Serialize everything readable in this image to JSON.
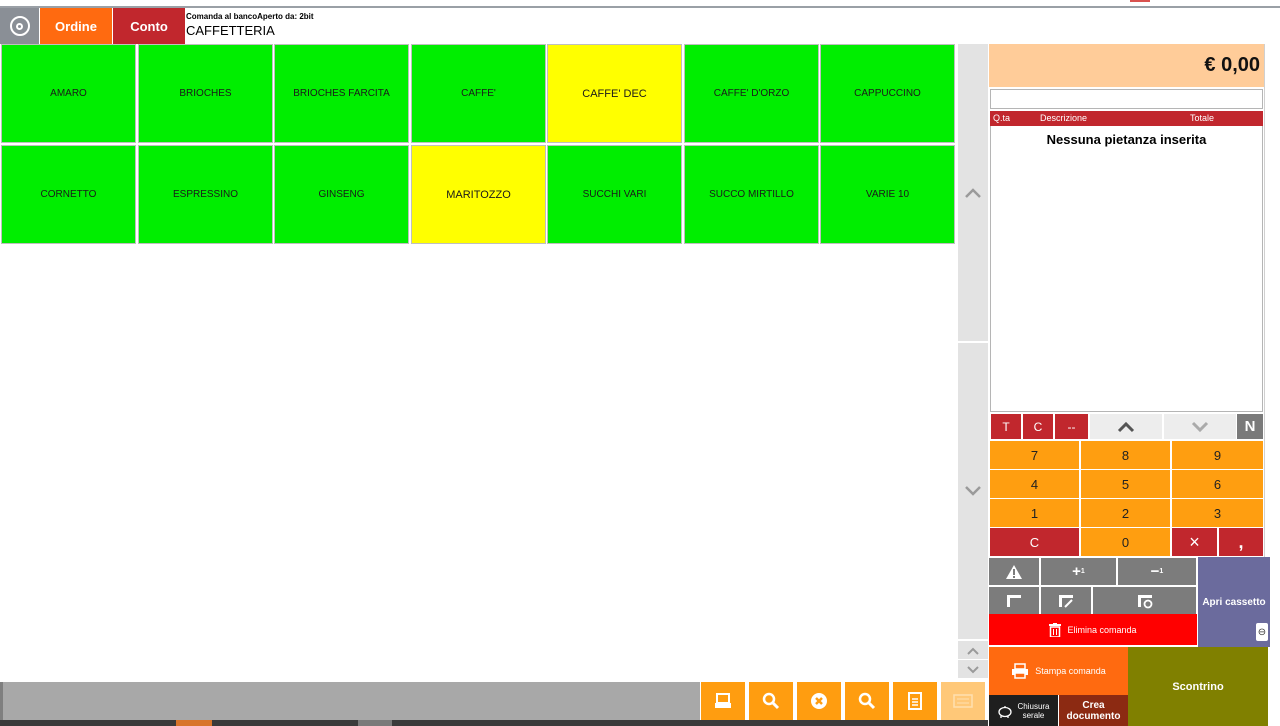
{
  "header": {
    "ordine_label": "Ordine",
    "conto_label": "Conto",
    "info_small": "Comanda al bancoAperto da: 2bit",
    "category": "CAFFETTERIA"
  },
  "products": [
    {
      "label": "AMARO",
      "color": "#00ee00"
    },
    {
      "label": "BRIOCHES",
      "color": "#00ee00"
    },
    {
      "label": "BRIOCHES FARCITA",
      "color": "#00ee00"
    },
    {
      "label": "CAFFE'",
      "color": "#00ee00"
    },
    {
      "label": "CAFFE' DEC",
      "color": "#ffff00"
    },
    {
      "label": "CAFFE' D'ORZO",
      "color": "#00ee00"
    },
    {
      "label": "CAPPUCCINO",
      "color": "#00ee00"
    },
    {
      "label": "CORNETTO",
      "color": "#00ee00"
    },
    {
      "label": "ESPRESSINO",
      "color": "#00ee00"
    },
    {
      "label": "GINSENG",
      "color": "#00ee00"
    },
    {
      "label": "MARITOZZO",
      "color": "#ffff00"
    },
    {
      "label": "SUCCHI VARI",
      "color": "#00ee00"
    },
    {
      "label": "SUCCO MIRTILLO",
      "color": "#00ee00"
    },
    {
      "label": "VARIE 10",
      "color": "#00ee00"
    }
  ],
  "order": {
    "total": "€ 0,00",
    "col_qty": "Q.ta",
    "col_desc": "Descrizione",
    "col_total": "Totale",
    "empty_text": "Nessuna pietanza inserita"
  },
  "controls": {
    "t": "T",
    "c": "C",
    "dash": "--",
    "n": "N"
  },
  "keypad": {
    "k7": "7",
    "k8": "8",
    "k9": "9",
    "k4": "4",
    "k5": "5",
    "k6": "6",
    "k1": "1",
    "k2": "2",
    "k3": "3",
    "kc": "C",
    "k0": "0",
    "kx": "×",
    "kcomma": ","
  },
  "actions": {
    "apri_cassetto": "Apri cassetto",
    "elimina_comanda": "Elimina comanda",
    "stampa_comanda": "Stampa comanda",
    "scontrino": "Scontrino",
    "chiusura_l1": "Chiusura",
    "chiusura_l2": "serale",
    "crea_l1": "Crea",
    "crea_l2": "documento",
    "plus_sup": "1",
    "minus_sup": "1"
  }
}
